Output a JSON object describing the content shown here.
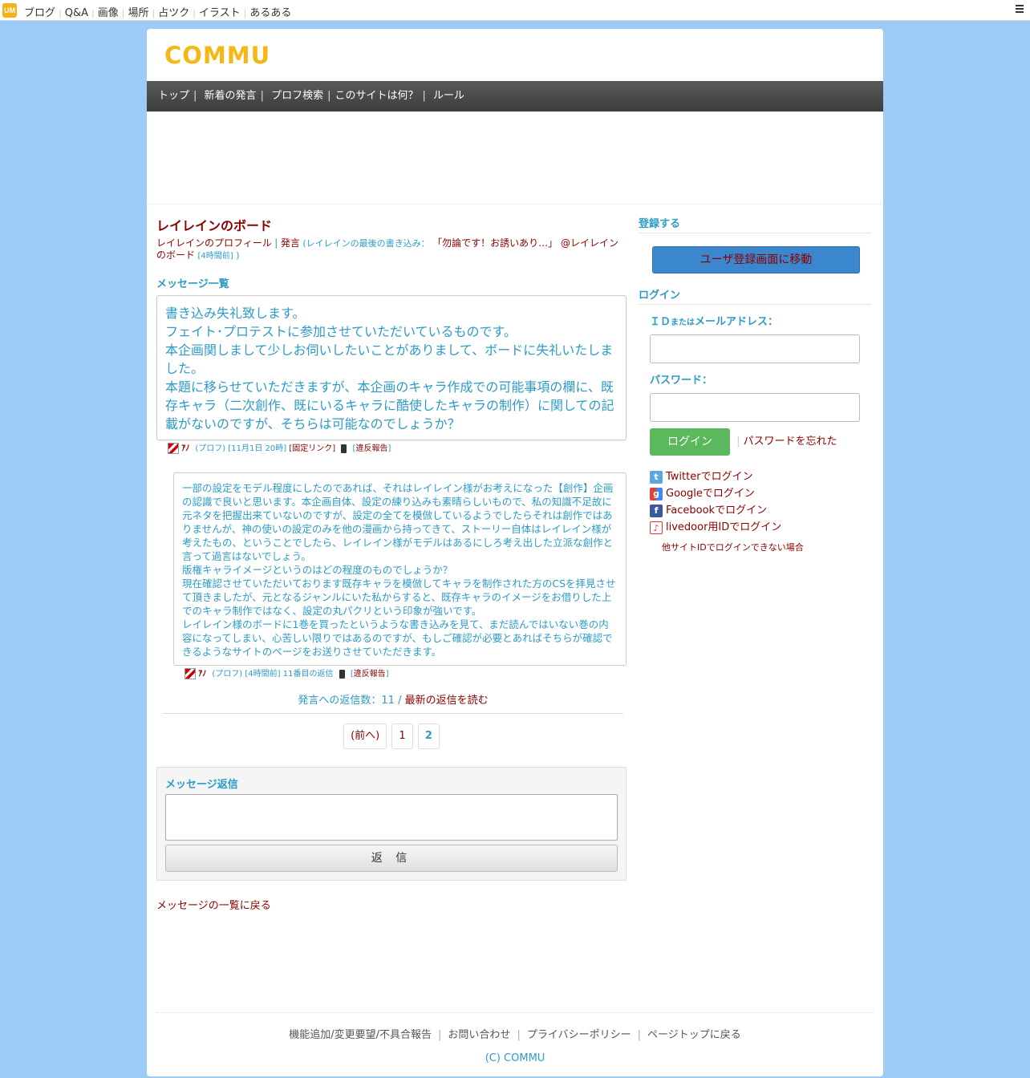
{
  "topbar": {
    "logo": "UM",
    "nav": [
      "ブログ",
      "Q&A",
      "画像",
      "場所",
      "占ツク",
      "イラスト",
      "あるある"
    ]
  },
  "site": {
    "brand": "COMMU",
    "gnav": [
      "トップ",
      "新着の発言",
      "プロフ検索",
      "このサイトは何？",
      "ルール"
    ]
  },
  "board": {
    "title": "レイレインのボード",
    "profile_link": "レイレインのプロフィール",
    "sep": "|",
    "post_link": "発言",
    "last_prefix": "(レイレインの最後の書き込み：",
    "last_quote": "「勿論です！お誘いあり…」 @レイレインのボード",
    "last_time": "[4時間前]",
    "last_suffix": ")"
  },
  "messages": {
    "heading": "メッセージ一覧",
    "main_post": "書き込み失礼致します。\nフェイト･プロテストに参加させていただいているものです。\n本企画関しまして少しお伺いしたいことがありまして、ボードに失礼いたしました。\n本題に移らせていただきますが、本企画のキャラ作成での可能事項の欄に、既存キャラ（二次創作、既にいるキャラに酷使したキャラの制作）に関しての記載がないのですが、そちらは可能なのでしょうか？",
    "main_meta": {
      "name": "ｱﾉ",
      "prof": "(プロフ)",
      "time": "[11月1日 20時]",
      "permalink": "[固定リンク]",
      "report": "違反報告",
      "report_open": "[",
      "report_close": "]"
    },
    "reply_post": "一部の設定をモデル程度にしたのであれば、それはレイレイン様がお考えになった【創作】企画の認識で良いと思います。本企画自体、設定の練り込みも素晴らしいもので、私の知識不足故に元ネタを把握出来ていないのですが、設定の全てを模倣しているようでしたらそれは創作ではありませんが、神の使いの設定のみを他の漫画から持ってきて、ストーリー自体はレイレイン様が考えたもの、ということでしたら、レイレイン様がモデルはあるにしろ考え出した立派な創作と言って過言はないでしょう。\n版権キャライメージというのはどの程度のものでしょうか？\n現在確認させていただいております既存キャラを模倣してキャラを制作された方のCSを拝見させて頂きましたが、元となるジャンルにいた私からすると、既存キャラのイメージをお借りした上でのキャラ制作ではなく、設定の丸パクリという印象が強いです。\nレイレイン様のボードに1巻を買ったというような書き込みを見て、まだ読んではいない巻の内容になってしまい、心苦しい限りではあるのですが、もしご確認が必要とあればそちらが確認できるようなサイトのページをお送りさせていただきます。",
    "reply_meta": {
      "name": "ｱﾉ",
      "prof": "(プロフ)",
      "time": "[4時間前]",
      "num": "11番目の返信",
      "report": "違反報告",
      "report_open": "[",
      "report_close": "]"
    },
    "reply_count_label": "発言への返信数：11 /",
    "read_latest": "最新の返信を読む"
  },
  "pager": {
    "prev": "(前へ)",
    "p1": "1",
    "p2": "2"
  },
  "reply_form": {
    "label": "メッセージ返信",
    "button": "返 信"
  },
  "back_link": "メッセージの一覧に戻る",
  "sidebar": {
    "register_h": "登録する",
    "register_btn": "ユーザ登録画面に移動",
    "login_h": "ログイン",
    "id_label_pre": "ＩＤ",
    "id_label_small": "または",
    "id_label_post": "メールアドレス：",
    "pw_label": "パスワード：",
    "login_btn": "ログイン",
    "bar": "|",
    "forgot": "パスワードを忘れた",
    "social": [
      {
        "icon": "twitter-icon",
        "label": "Twitterでログイン"
      },
      {
        "icon": "google-icon",
        "label": "Googleでログイン"
      },
      {
        "icon": "facebook-icon",
        "label": "Facebookでログイン"
      },
      {
        "icon": "livedoor-icon",
        "label": "livedoor用IDでログイン"
      }
    ],
    "other": "他サイトIDでログインできない場合"
  },
  "footer": {
    "links": [
      "機能追加/変更要望/不具合報告",
      "お問い合わせ",
      "プライバシーポリシー",
      "ページトップに戻る"
    ],
    "sep": "|",
    "copy": "(C) COMMU"
  },
  "colors": {
    "background": "#9ccbf5",
    "brand": "#f5b715",
    "link_red": "#8b0000",
    "text_cyan": "#2d9bc6",
    "login_green": "#5cb85c",
    "register_blue": "#3a87cd"
  }
}
